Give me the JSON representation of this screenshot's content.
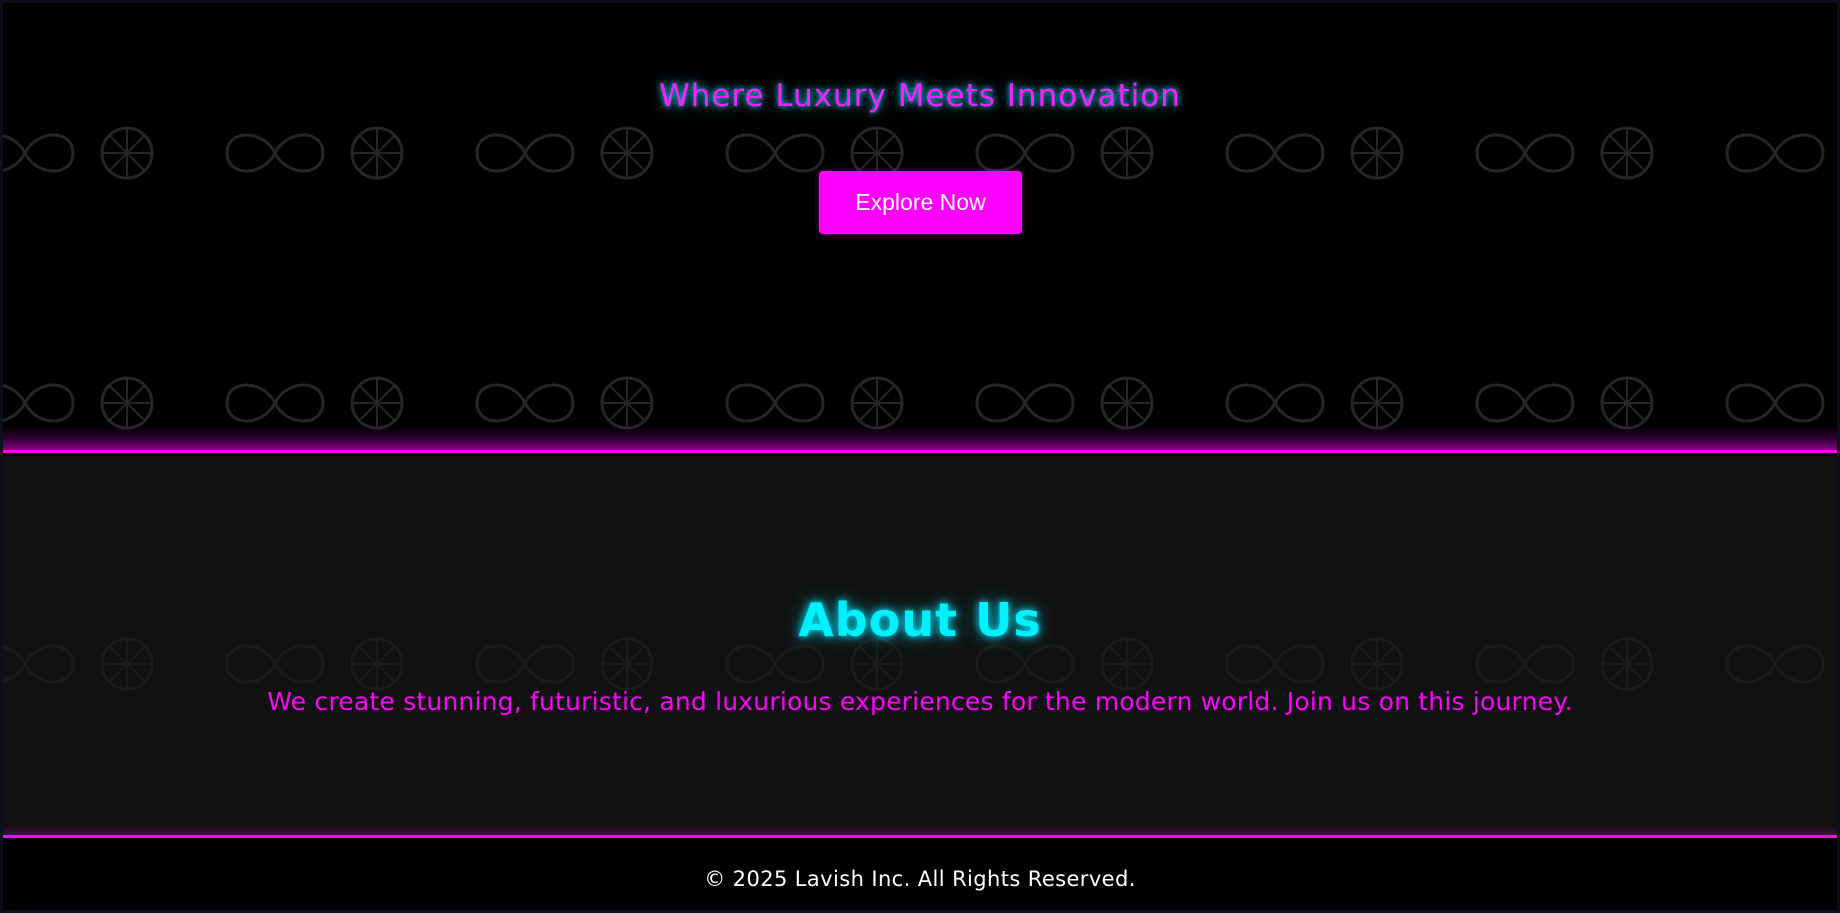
{
  "hero": {
    "tagline": "Where Luxury Meets Innovation",
    "cta_label": "Explore Now"
  },
  "about": {
    "title": "About Us",
    "description": "We create stunning, futuristic, and luxurious experiences for the modern world. Join us on this journey."
  },
  "footer": {
    "copyright": "© 2025 Lavish Inc. All Rights Reserved."
  },
  "theme": {
    "accent_magenta": "#ff00ff",
    "accent_cyan": "#00f0ff",
    "hero_background": "#000000",
    "about_background": "#111111",
    "footer_background": "#000000",
    "pattern_icons": [
      "infinity-icon",
      "wheel-icon"
    ]
  }
}
